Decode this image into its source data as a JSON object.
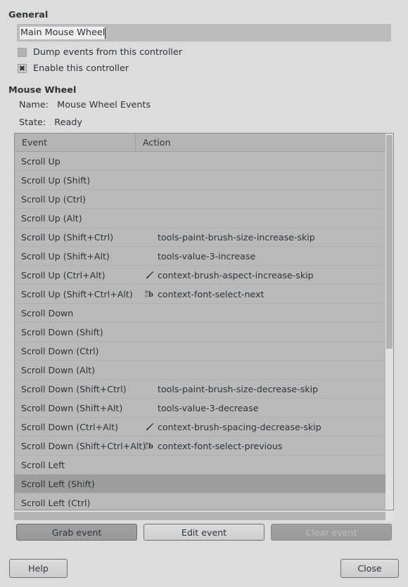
{
  "general": {
    "heading": "General",
    "name_entry": {
      "value": "Main Mouse Wheel",
      "placeholder": ""
    },
    "checkboxes": [
      {
        "label": "Dump events from this controller",
        "checked": false,
        "icon": "checkbox-unchecked-icon",
        "mark": ""
      },
      {
        "label": "Enable this controller",
        "checked": true,
        "icon": "checkbox-checked-icon",
        "mark": "✖"
      }
    ]
  },
  "device": {
    "heading": "Mouse Wheel",
    "name_key": "Name:",
    "name_value": "Mouse Wheel Events",
    "state_key": "State:",
    "state_value": "Ready"
  },
  "list": {
    "columns": [
      "Event",
      "Action"
    ],
    "rows": [
      {
        "event": "Scroll Up",
        "action": "",
        "icon": ""
      },
      {
        "event": "Scroll Up (Shift)",
        "action": "",
        "icon": ""
      },
      {
        "event": "Scroll Up (Ctrl)",
        "action": "",
        "icon": ""
      },
      {
        "event": "Scroll Up (Alt)",
        "action": "",
        "icon": ""
      },
      {
        "event": "Scroll Up (Shift+Ctrl)",
        "action": "tools-paint-brush-size-increase-skip",
        "icon": ""
      },
      {
        "event": "Scroll Up (Shift+Alt)",
        "action": "tools-value-3-increase",
        "icon": ""
      },
      {
        "event": "Scroll Up (Ctrl+Alt)",
        "action": "context-brush-aspect-increase-skip",
        "icon": "paintbrush-icon"
      },
      {
        "event": "Scroll Up (Shift+Ctrl+Alt)",
        "action": "context-font-select-next",
        "icon": "font-icon"
      },
      {
        "event": "Scroll Down",
        "action": "",
        "icon": ""
      },
      {
        "event": "Scroll Down (Shift)",
        "action": "",
        "icon": ""
      },
      {
        "event": "Scroll Down (Ctrl)",
        "action": "",
        "icon": ""
      },
      {
        "event": "Scroll Down (Alt)",
        "action": "",
        "icon": ""
      },
      {
        "event": "Scroll Down (Shift+Ctrl)",
        "action": "tools-paint-brush-size-decrease-skip",
        "icon": ""
      },
      {
        "event": "Scroll Down (Shift+Alt)",
        "action": "tools-value-3-decrease",
        "icon": ""
      },
      {
        "event": "Scroll Down (Ctrl+Alt)",
        "action": "context-brush-spacing-decrease-skip",
        "icon": "paintbrush-icon"
      },
      {
        "event": "Scroll Down (Shift+Ctrl+Alt)",
        "action": "context-font-select-previous",
        "icon": "font-icon"
      },
      {
        "event": "Scroll Left",
        "action": "",
        "icon": ""
      },
      {
        "event": "Scroll Left (Shift)",
        "action": "",
        "icon": "",
        "selected": true
      },
      {
        "event": "Scroll Left (Ctrl)",
        "action": "",
        "icon": ""
      }
    ],
    "selected_index": 17
  },
  "event_buttons": [
    {
      "label": "Grab event",
      "state": "active"
    },
    {
      "label": "Edit event",
      "state": "normal"
    },
    {
      "label": "Clear event",
      "state": "disabled"
    }
  ],
  "footer": {
    "help_label": "Help",
    "close_label": "Close"
  },
  "colors": {
    "window_bg": "#dcdcdc",
    "list_bg": "#b9b9b9",
    "selection": "#9d9d9d",
    "entry_bg": "#bbbbbb",
    "text": "#2e3436",
    "button_active": "#a0a0a0"
  }
}
